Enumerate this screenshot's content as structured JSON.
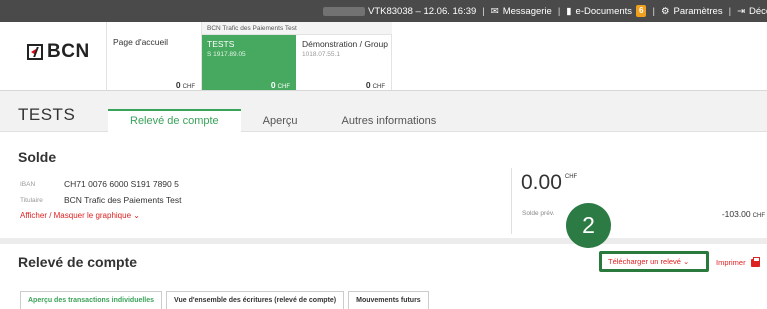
{
  "topbar": {
    "session": "VTK83038 – 12.06. 16:39",
    "messagerie": "Messagerie",
    "edocuments": "e-Documents",
    "edocuments_count": "6",
    "parametres": "Paramètres",
    "deconnexion": "Déconnexi"
  },
  "logo": {
    "text": "BCN"
  },
  "home": {
    "label": "Page d'accueil",
    "amount": "0",
    "currency": "CHF"
  },
  "group_title": "BCN Trafic des Paiements Test",
  "accounts": [
    {
      "name": "TESTS",
      "number": "S 1917.89.05",
      "amount": "0",
      "currency": "CHF"
    },
    {
      "name": "Démonstration / Group",
      "number": "1018.07.55.1",
      "amount": "0",
      "currency": "CHF"
    }
  ],
  "account_title": "TESTS",
  "tabs": [
    "Relevé de compte",
    "Aperçu",
    "Autres informations"
  ],
  "solde": {
    "heading": "Solde",
    "iban_label": "IBAN",
    "iban_value": "CH71 0076 6000 S191 7890 5",
    "holder_label": "Titulaire",
    "holder_value": "BCN Trafic des Paiements Test",
    "graph_link": "Afficher / Masquer le graphique ⌄",
    "balance": "0.00",
    "balance_currency": "CHF",
    "prev_label": "Solde prév.",
    "prev_value": "-103.00",
    "prev_currency": "CHF"
  },
  "step_badge": "2",
  "releve": {
    "heading": "Relevé de compte",
    "download": "Télécharger un relevé ⌄",
    "print": "Imprimer"
  },
  "subtabs": [
    "Aperçu des transactions individuelles",
    "Vue d'ensemble des écritures (relevé de compte)",
    "Mouvements futurs"
  ],
  "colors": {
    "accent_green": "#47a960",
    "highlight_green": "#2a7a3e",
    "link_red": "#dd2222",
    "topbar": "#4a4a4a"
  }
}
